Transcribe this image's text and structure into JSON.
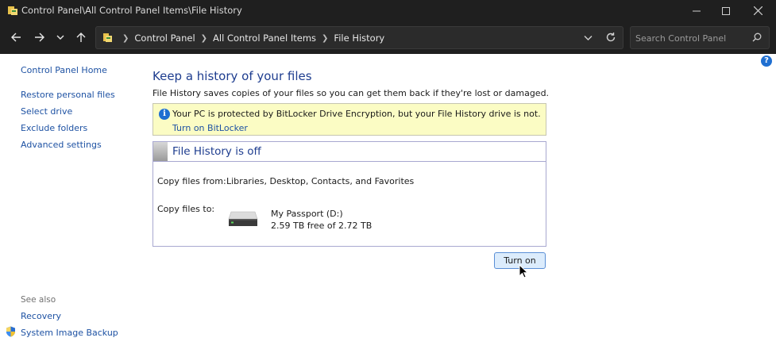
{
  "window": {
    "title": "Control Panel\\All Control Panel Items\\File History"
  },
  "address": {
    "breadcrumbs": [
      "Control Panel",
      "All Control Panel Items",
      "File History"
    ]
  },
  "search": {
    "placeholder": "Search Control Panel"
  },
  "sidebar": {
    "home": "Control Panel Home",
    "links": [
      "Restore personal files",
      "Select drive",
      "Exclude folders",
      "Advanced settings"
    ],
    "see_also_label": "See also",
    "see_also": [
      "Recovery",
      "System Image Backup"
    ]
  },
  "main": {
    "title": "Keep a history of your files",
    "description": "File History saves copies of your files so you can get them back if they're lost or damaged.",
    "notice": {
      "text": "Your PC is protected by BitLocker Drive Encryption, but your File History drive is not.",
      "link": "Turn on BitLocker"
    },
    "status": {
      "title": "File History is off",
      "copy_from_label": "Copy files from:",
      "copy_from_value": "Libraries, Desktop, Contacts, and Favorites",
      "copy_to_label": "Copy files to:",
      "drive_name": "My Passport (D:)",
      "drive_space": "2.59 TB free of 2.72 TB"
    },
    "turn_on_button": "Turn on"
  },
  "icons": {
    "window": "control-panel-icon",
    "info": "info-icon",
    "help": "help-icon",
    "drive": "hard-drive-icon",
    "shield": "uac-shield-icon"
  },
  "colors": {
    "link": "#1e52a3",
    "heading": "#1e3d8f",
    "notice_bg": "#fbfcc4",
    "chrome": "#1f1f1f",
    "button_bg": "#dcecfc"
  }
}
